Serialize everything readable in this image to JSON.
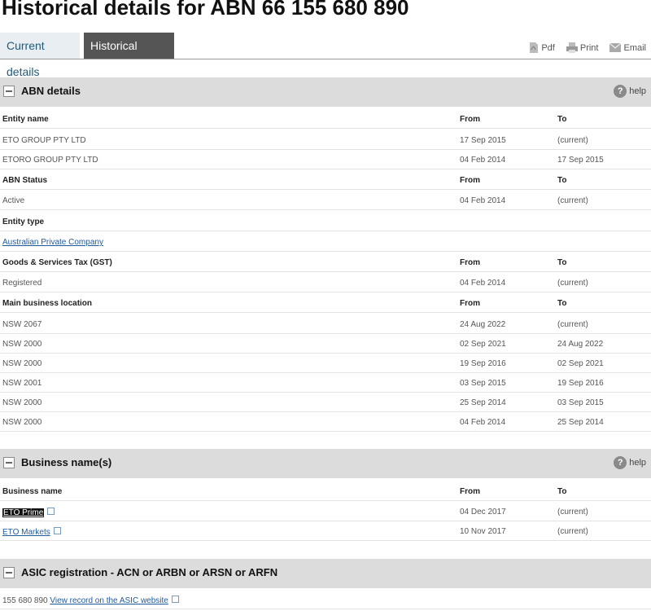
{
  "page_title": "Historical details for ABN 66 155 680 890",
  "tabs": {
    "current": "Current details",
    "historical": "Historical details"
  },
  "tools": {
    "pdf": "Pdf",
    "print": "Print",
    "email": "Email"
  },
  "help_label": "help",
  "abn": {
    "title": "ABN details",
    "entity_name": {
      "label": "Entity name",
      "from": "From",
      "to": "To",
      "rows": [
        {
          "name": "ETO GROUP PTY LTD",
          "from": "17 Sep 2015",
          "to": "(current)"
        },
        {
          "name": "ETORO GROUP PTY LTD",
          "from": "04 Feb 2014",
          "to": "17 Sep 2015"
        }
      ]
    },
    "status": {
      "label": "ABN Status",
      "from": "From",
      "to": "To",
      "rows": [
        {
          "name": "Active",
          "from": "04 Feb 2014",
          "to": "(current)"
        }
      ]
    },
    "entity_type": {
      "label": "Entity type",
      "value": "Australian Private Company"
    },
    "gst": {
      "label": "Goods & Services Tax (GST)",
      "from": "From",
      "to": "To",
      "rows": [
        {
          "name": "Registered",
          "from": "04 Feb 2014",
          "to": "(current)"
        }
      ]
    },
    "location": {
      "label": "Main business location",
      "from": "From",
      "to": "To",
      "rows": [
        {
          "name": "NSW 2067",
          "from": "24 Aug 2022",
          "to": "(current)"
        },
        {
          "name": "NSW 2000",
          "from": "02 Sep 2021",
          "to": "24 Aug 2022"
        },
        {
          "name": "NSW 2000",
          "from": "19 Sep 2016",
          "to": "02 Sep 2021"
        },
        {
          "name": "NSW 2001",
          "from": "03 Sep 2015",
          "to": "19 Sep 2016"
        },
        {
          "name": "NSW 2000",
          "from": "25 Sep 2014",
          "to": "03 Sep 2015"
        },
        {
          "name": "NSW 2000",
          "from": "04 Feb 2014",
          "to": "25 Sep 2014"
        }
      ]
    }
  },
  "business": {
    "title": "Business name(s)",
    "label": "Business name",
    "from": "From",
    "to": "To",
    "rows": [
      {
        "name": "ETO Prime",
        "from": "04 Dec 2017",
        "to": "(current)"
      },
      {
        "name": "ETO Markets",
        "from": "10 Nov 2017",
        "to": "(current)"
      }
    ]
  },
  "asic": {
    "title": "ASIC registration - ACN or ARBN or ARSN or ARFN",
    "number": "155 680 890",
    "link": "View record on the ASIC website"
  }
}
